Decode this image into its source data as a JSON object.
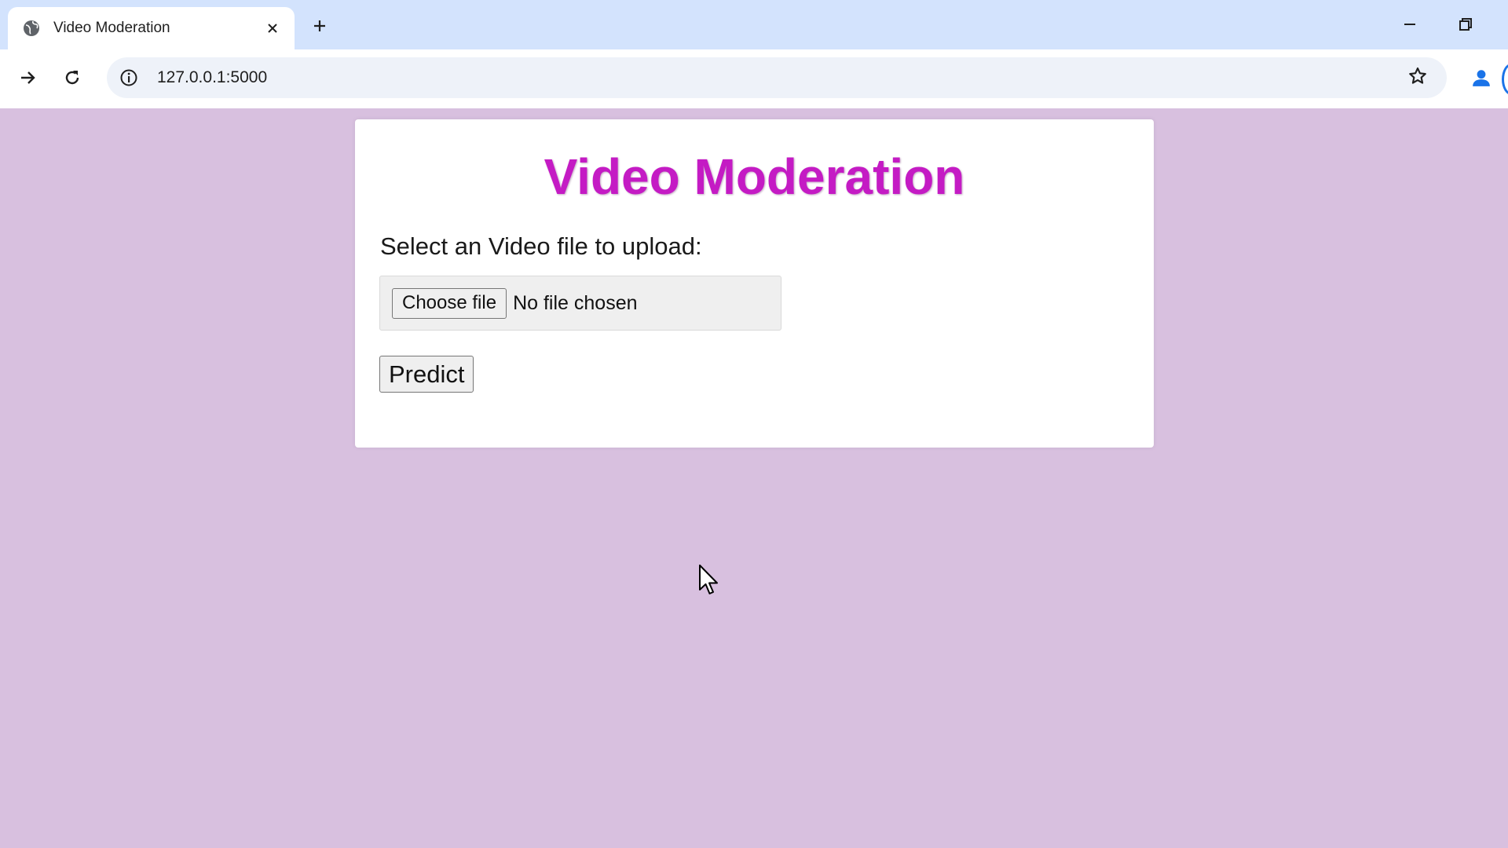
{
  "browser": {
    "tab": {
      "title": "Video Moderation",
      "favicon_icon": "globe-icon",
      "close_icon": "close-icon"
    },
    "new_tab_icon": "plus-icon",
    "window_controls": [
      "minimize-icon",
      "restore-icon"
    ],
    "toolbar": {
      "forward_icon": "arrow-forward-icon",
      "reload_icon": "reload-icon",
      "site_info_icon": "info-icon",
      "url": "127.0.0.1:5000",
      "bookmark_icon": "star-icon",
      "profile_icon": "person-icon"
    }
  },
  "page": {
    "title": "Video Moderation",
    "upload_label": "Select an Video file to upload:",
    "file_input": {
      "button_label": "Choose file",
      "status": "No file chosen"
    },
    "predict_label": "Predict",
    "colors": {
      "title": "#c41bc4",
      "background": "#d8c0df",
      "card": "#ffffff"
    }
  }
}
